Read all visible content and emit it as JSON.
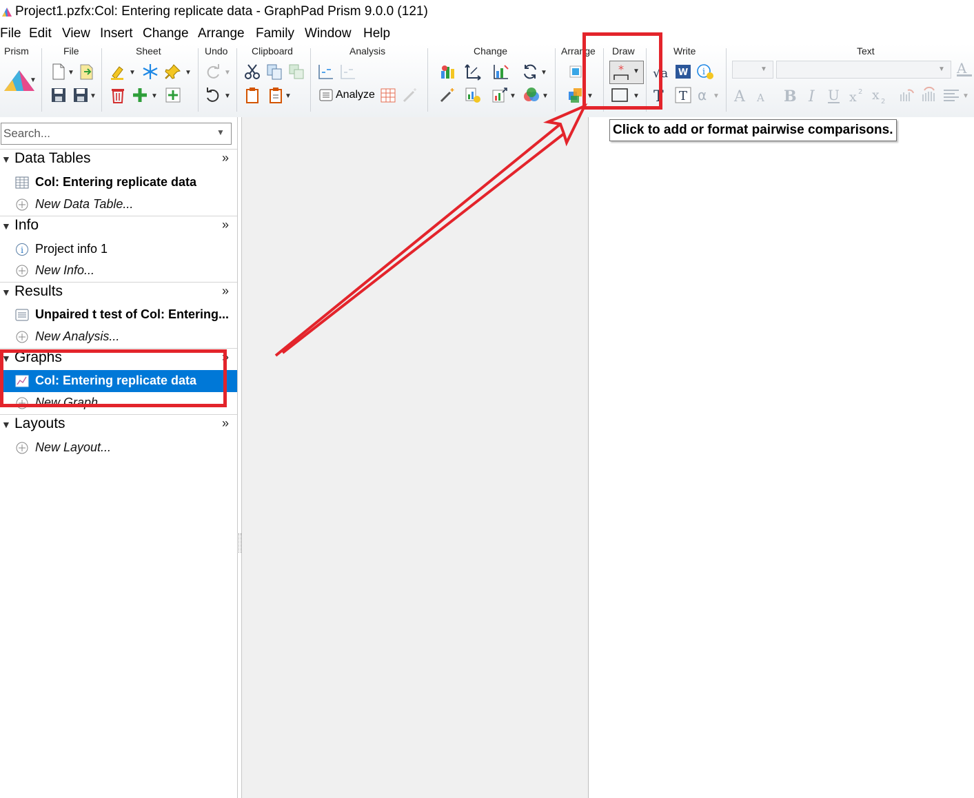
{
  "window": {
    "title": "Project1.pzfx:Col: Entering replicate data - GraphPad Prism 9.0.0 (121)"
  },
  "menu": [
    "File",
    "Edit",
    "View",
    "Insert",
    "Change",
    "Arrange",
    "Family",
    "Window",
    "Help"
  ],
  "toolbar": {
    "groups": [
      "Prism",
      "File",
      "Sheet",
      "Undo",
      "Clipboard",
      "Analysis",
      "Change",
      "Arrange",
      "Draw",
      "Write",
      "Text"
    ],
    "analyze_label": "Analyze"
  },
  "navigator": {
    "search_placeholder": "Search...",
    "sections": [
      {
        "name": "Data Tables",
        "items": [
          {
            "label": "Col: Entering replicate data",
            "icon": "data-table-icon"
          },
          {
            "label": "New Data Table...",
            "icon": "plus-circle-icon"
          }
        ]
      },
      {
        "name": "Info",
        "items": [
          {
            "label": "Project info 1",
            "icon": "info-icon"
          },
          {
            "label": "New Info...",
            "icon": "plus-circle-icon"
          }
        ]
      },
      {
        "name": "Results",
        "items": [
          {
            "label": "Unpaired t test of Col: Entering...",
            "icon": "results-icon"
          },
          {
            "label": "New Analysis...",
            "icon": "plus-circle-icon"
          }
        ]
      },
      {
        "name": "Graphs",
        "items": [
          {
            "label": "Col: Entering replicate data",
            "icon": "graph-icon",
            "selected": true
          },
          {
            "label": "New Graph...",
            "icon": "plus-circle-icon"
          }
        ]
      },
      {
        "name": "Layouts",
        "items": [
          {
            "label": "New Layout...",
            "icon": "plus-circle-icon"
          }
        ]
      }
    ],
    "more_glyph": "»"
  },
  "tooltip": {
    "text": "Click to add or format pairwise comparisons."
  },
  "colors": {
    "selection": "#0078d7",
    "annotation_red": "#e3242b"
  }
}
